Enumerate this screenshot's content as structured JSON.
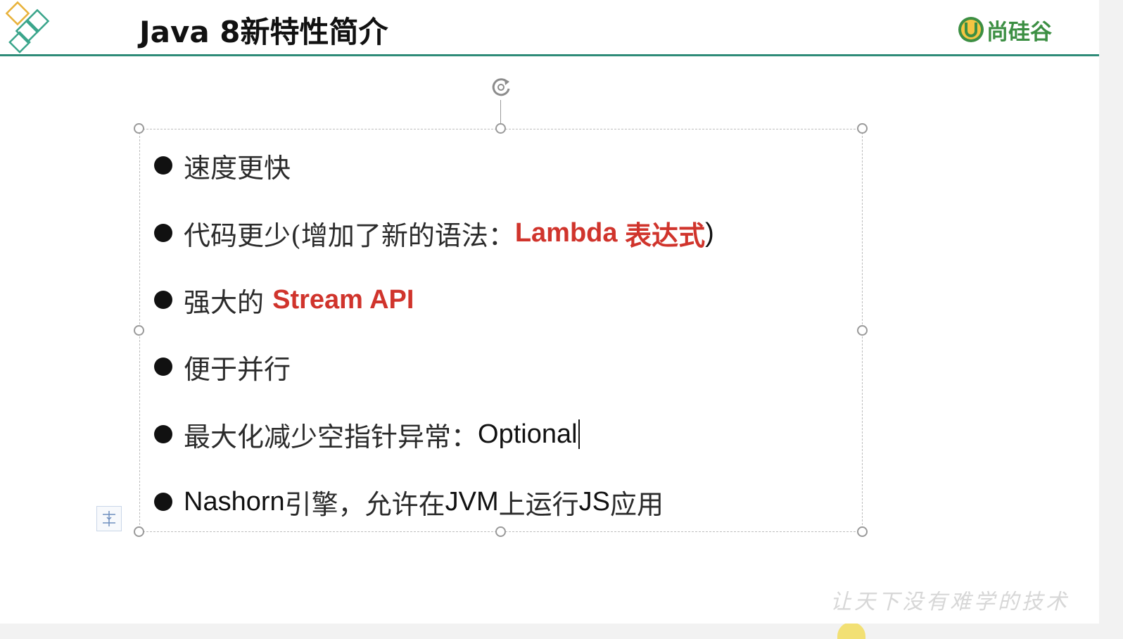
{
  "slide": {
    "title": "Java 8新特性简介",
    "brand": {
      "name": "尚硅谷",
      "mark_letter": "U",
      "color": "#3c8f43"
    },
    "accent_color": "#2e8b78",
    "bullets": [
      {
        "segments": [
          {
            "text": "速度更快",
            "style": "cjk"
          }
        ]
      },
      {
        "segments": [
          {
            "text": "代码更少(增加了新的语法：",
            "style": "cjk"
          },
          {
            "text": "Lambda ",
            "style": "red"
          },
          {
            "text": "表达式",
            "style": "red-cjk"
          },
          {
            "text": ")",
            "style": "latin"
          }
        ]
      },
      {
        "segments": [
          {
            "text": "强大的 ",
            "style": "cjk"
          },
          {
            "text": "Stream API",
            "style": "red"
          }
        ]
      },
      {
        "segments": [
          {
            "text": "便于并行",
            "style": "cjk"
          }
        ]
      },
      {
        "segments": [
          {
            "text": "最大化减少空指针异常：",
            "style": "cjk"
          },
          {
            "text": "Optional",
            "style": "latin"
          }
        ],
        "has_caret": true
      },
      {
        "segments": [
          {
            "text": "Nashorn",
            "style": "latin"
          },
          {
            "text": "引擎，允许在",
            "style": "cjk"
          },
          {
            "text": "JVM",
            "style": "latin"
          },
          {
            "text": "上运行",
            "style": "cjk"
          },
          {
            "text": "JS",
            "style": "latin"
          },
          {
            "text": "应用",
            "style": "cjk"
          }
        ]
      }
    ],
    "highlight_color": "#d0342c",
    "watermark": "让天下没有难学的技术"
  },
  "icons": {
    "rotate": "rotate-handle-icon",
    "layout": "layout-options-icon",
    "logo": "diamond-logo-icon"
  }
}
